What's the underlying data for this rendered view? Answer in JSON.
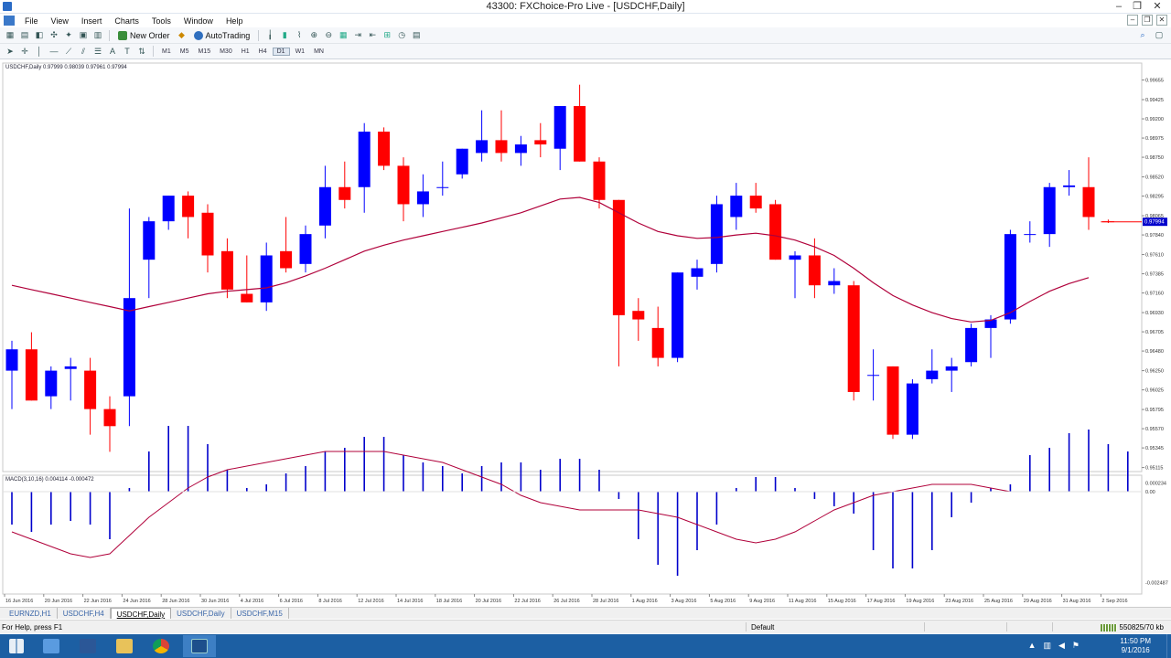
{
  "window": {
    "title": "43300: FXChoice-Pro Live - [USDCHF,Daily]"
  },
  "menu": [
    "File",
    "View",
    "Insert",
    "Charts",
    "Tools",
    "Window",
    "Help"
  ],
  "toolbar": {
    "new_order": "New Order",
    "autotrading": "AutoTrading"
  },
  "timeframes": [
    "M1",
    "M5",
    "M15",
    "M30",
    "H1",
    "H4",
    "D1",
    "W1",
    "MN"
  ],
  "chart": {
    "header": "USDCHF,Daily  0.97999 0.98039 0.97961 0.97994",
    "price_ticks": [
      "0.99655",
      "0.99425",
      "0.99200",
      "0.98975",
      "0.98750",
      "0.98520",
      "0.98295",
      "0.98065",
      "0.97840",
      "0.97610",
      "0.97385",
      "0.97160",
      "0.96930",
      "0.96705",
      "0.96480",
      "0.96250",
      "0.96025",
      "0.95795",
      "0.95570",
      "0.95345",
      "0.95115"
    ],
    "current_price": "0.97994",
    "macd_header": "MACD(3,10,16) 0.004114 -0.000472",
    "macd_ticks": [
      "0.000234",
      "0.00",
      "-0.002487"
    ],
    "date_ticks": [
      "16 Jun 2016",
      "20 Jun 2016",
      "22 Jun 2016",
      "24 Jun 2016",
      "28 Jun 2016",
      "30 Jun 2016",
      "4 Jul 2016",
      "6 Jul 2016",
      "8 Jul 2016",
      "12 Jul 2016",
      "14 Jul 2016",
      "18 Jul 2016",
      "20 Jul 2016",
      "22 Jul 2016",
      "26 Jul 2016",
      "28 Jul 2016",
      "1 Aug 2016",
      "3 Aug 2016",
      "5 Aug 2016",
      "9 Aug 2016",
      "11 Aug 2016",
      "15 Aug 2016",
      "17 Aug 2016",
      "19 Aug 2016",
      "23 Aug 2016",
      "25 Aug 2016",
      "29 Aug 2016",
      "31 Aug 2016",
      "2 Sep 2016"
    ]
  },
  "chart_data": {
    "type": "candlestick",
    "symbol": "USDCHF",
    "timeframe": "Daily",
    "ylim": [
      0.951,
      0.998
    ],
    "up_color": "#0000ff",
    "down_color": "#ff0000",
    "ma_color": "#b0003a",
    "candles": [
      {
        "o": 0.9625,
        "h": 0.966,
        "l": 0.958,
        "c": 0.965
      },
      {
        "o": 0.965,
        "h": 0.967,
        "l": 0.959,
        "c": 0.959
      },
      {
        "o": 0.9595,
        "h": 0.963,
        "l": 0.958,
        "c": 0.9625
      },
      {
        "o": 0.9627,
        "h": 0.964,
        "l": 0.959,
        "c": 0.963
      },
      {
        "o": 0.9625,
        "h": 0.964,
        "l": 0.955,
        "c": 0.958
      },
      {
        "o": 0.958,
        "h": 0.9595,
        "l": 0.953,
        "c": 0.956
      },
      {
        "o": 0.9595,
        "h": 0.9815,
        "l": 0.956,
        "c": 0.971
      },
      {
        "o": 0.9755,
        "h": 0.9805,
        "l": 0.971,
        "c": 0.98
      },
      {
        "o": 0.98,
        "h": 0.983,
        "l": 0.979,
        "c": 0.983
      },
      {
        "o": 0.983,
        "h": 0.9835,
        "l": 0.978,
        "c": 0.9805
      },
      {
        "o": 0.981,
        "h": 0.982,
        "l": 0.974,
        "c": 0.976
      },
      {
        "o": 0.9765,
        "h": 0.978,
        "l": 0.971,
        "c": 0.972
      },
      {
        "o": 0.9715,
        "h": 0.976,
        "l": 0.9705,
        "c": 0.9705
      },
      {
        "o": 0.9705,
        "h": 0.9775,
        "l": 0.9695,
        "c": 0.976
      },
      {
        "o": 0.9765,
        "h": 0.9805,
        "l": 0.974,
        "c": 0.9745
      },
      {
        "o": 0.975,
        "h": 0.9795,
        "l": 0.974,
        "c": 0.9785
      },
      {
        "o": 0.9795,
        "h": 0.9865,
        "l": 0.978,
        "c": 0.984
      },
      {
        "o": 0.984,
        "h": 0.987,
        "l": 0.9815,
        "c": 0.9825
      },
      {
        "o": 0.984,
        "h": 0.9915,
        "l": 0.981,
        "c": 0.9905
      },
      {
        "o": 0.9905,
        "h": 0.991,
        "l": 0.986,
        "c": 0.9865
      },
      {
        "o": 0.9865,
        "h": 0.9875,
        "l": 0.98,
        "c": 0.982
      },
      {
        "o": 0.982,
        "h": 0.9855,
        "l": 0.9805,
        "c": 0.9835
      },
      {
        "o": 0.984,
        "h": 0.987,
        "l": 0.983,
        "c": 0.984
      },
      {
        "o": 0.9855,
        "h": 0.9885,
        "l": 0.985,
        "c": 0.9885
      },
      {
        "o": 0.988,
        "h": 0.993,
        "l": 0.987,
        "c": 0.9895
      },
      {
        "o": 0.9895,
        "h": 0.993,
        "l": 0.987,
        "c": 0.988
      },
      {
        "o": 0.988,
        "h": 0.99,
        "l": 0.9865,
        "c": 0.989
      },
      {
        "o": 0.9895,
        "h": 0.9915,
        "l": 0.9875,
        "c": 0.989
      },
      {
        "o": 0.9885,
        "h": 0.9935,
        "l": 0.986,
        "c": 0.9935
      },
      {
        "o": 0.9935,
        "h": 0.996,
        "l": 0.987,
        "c": 0.987
      },
      {
        "o": 0.987,
        "h": 0.9875,
        "l": 0.9815,
        "c": 0.9825
      },
      {
        "o": 0.9825,
        "h": 0.9825,
        "l": 0.963,
        "c": 0.969
      },
      {
        "o": 0.9695,
        "h": 0.971,
        "l": 0.966,
        "c": 0.9685
      },
      {
        "o": 0.9675,
        "h": 0.97,
        "l": 0.963,
        "c": 0.964
      },
      {
        "o": 0.964,
        "h": 0.974,
        "l": 0.9635,
        "c": 0.974
      },
      {
        "o": 0.9735,
        "h": 0.9755,
        "l": 0.972,
        "c": 0.9745
      },
      {
        "o": 0.975,
        "h": 0.983,
        "l": 0.974,
        "c": 0.982
      },
      {
        "o": 0.9805,
        "h": 0.9845,
        "l": 0.979,
        "c": 0.983
      },
      {
        "o": 0.983,
        "h": 0.9845,
        "l": 0.981,
        "c": 0.9815
      },
      {
        "o": 0.982,
        "h": 0.9825,
        "l": 0.9755,
        "c": 0.9755
      },
      {
        "o": 0.9755,
        "h": 0.9765,
        "l": 0.971,
        "c": 0.976
      },
      {
        "o": 0.976,
        "h": 0.978,
        "l": 0.971,
        "c": 0.9725
      },
      {
        "o": 0.9725,
        "h": 0.9745,
        "l": 0.9715,
        "c": 0.973
      },
      {
        "o": 0.9725,
        "h": 0.973,
        "l": 0.959,
        "c": 0.96
      },
      {
        "o": 0.962,
        "h": 0.965,
        "l": 0.959,
        "c": 0.962
      },
      {
        "o": 0.963,
        "h": 0.963,
        "l": 0.9545,
        "c": 0.955
      },
      {
        "o": 0.955,
        "h": 0.9615,
        "l": 0.9545,
        "c": 0.961
      },
      {
        "o": 0.9615,
        "h": 0.965,
        "l": 0.961,
        "c": 0.9625
      },
      {
        "o": 0.9625,
        "h": 0.964,
        "l": 0.96,
        "c": 0.963
      },
      {
        "o": 0.9635,
        "h": 0.968,
        "l": 0.963,
        "c": 0.9675
      },
      {
        "o": 0.9675,
        "h": 0.969,
        "l": 0.964,
        "c": 0.9685
      },
      {
        "o": 0.9685,
        "h": 0.979,
        "l": 0.968,
        "c": 0.9785
      },
      {
        "o": 0.9785,
        "h": 0.98,
        "l": 0.9775,
        "c": 0.9785
      },
      {
        "o": 0.9785,
        "h": 0.9845,
        "l": 0.977,
        "c": 0.984
      },
      {
        "o": 0.984,
        "h": 0.986,
        "l": 0.983,
        "c": 0.9842
      },
      {
        "o": 0.984,
        "h": 0.9875,
        "l": 0.979,
        "c": 0.9805
      },
      {
        "o": 0.98,
        "h": 0.9802,
        "l": 0.9798,
        "c": 0.9799
      }
    ],
    "ma": [
      0.9725,
      0.972,
      0.9715,
      0.971,
      0.9705,
      0.97,
      0.9695,
      0.97,
      0.9705,
      0.971,
      0.9715,
      0.9718,
      0.972,
      0.9722,
      0.9728,
      0.9736,
      0.9745,
      0.9755,
      0.9765,
      0.9772,
      0.9778,
      0.9783,
      0.9788,
      0.9793,
      0.9798,
      0.9804,
      0.981,
      0.9818,
      0.9826,
      0.9828,
      0.9822,
      0.981,
      0.9798,
      0.9788,
      0.9783,
      0.978,
      0.9781,
      0.9784,
      0.9786,
      0.9783,
      0.9778,
      0.977,
      0.976,
      0.9745,
      0.9728,
      0.9713,
      0.9702,
      0.9693,
      0.9686,
      0.9682,
      0.9684,
      0.9693,
      0.9706,
      0.9718,
      0.9727,
      0.9734
    ],
    "macd": {
      "ylim": [
        -0.0027,
        0.00035
      ],
      "hist": [
        -0.0009,
        -0.0011,
        -0.0009,
        -0.0008,
        -0.0009,
        -0.0013,
        0.0001,
        0.0011,
        0.0018,
        0.0018,
        0.0013,
        0.0006,
        0.0001,
        0.0002,
        0.0005,
        0.0007,
        0.0011,
        0.0012,
        0.0015,
        0.0015,
        0.001,
        0.0008,
        0.0007,
        0.0005,
        0.0007,
        0.0008,
        0.0008,
        0.0006,
        0.0009,
        0.0009,
        0.0006,
        -0.0002,
        -0.0013,
        -0.002,
        -0.0023,
        -0.0016,
        -0.0009,
        0.0001,
        0.0004,
        0.0004,
        0.0001,
        -0.0002,
        -0.0004,
        -0.0006,
        -0.0016,
        -0.0021,
        -0.0021,
        -0.0016,
        -0.0007,
        -0.0003,
        0.0001,
        0.0002,
        0.001,
        0.0012,
        0.0016,
        0.0017,
        0.0013,
        0.0011
      ],
      "signal": [
        -0.0011,
        -0.0013,
        -0.0015,
        -0.0017,
        -0.0018,
        -0.0017,
        -0.0012,
        -0.0007,
        -0.0003,
        0.0001,
        0.0004,
        0.0006,
        0.0007,
        0.0008,
        0.0009,
        0.001,
        0.0011,
        0.0011,
        0.0011,
        0.0011,
        0.001,
        0.0009,
        0.0008,
        0.0006,
        0.0004,
        0.0002,
        -0.0001,
        -0.0003,
        -0.0004,
        -0.0005,
        -0.0005,
        -0.0005,
        -0.0005,
        -0.0006,
        -0.0007,
        -0.0009,
        -0.0011,
        -0.0013,
        -0.0014,
        -0.0013,
        -0.0011,
        -0.0008,
        -0.0005,
        -0.0003,
        -0.0001,
        0.0,
        0.0001,
        0.0002,
        0.0002,
        0.0002,
        0.0001,
        0.0
      ]
    }
  },
  "tabs": [
    "EURNZD,H1",
    "USDCHF,H4",
    "USDCHF,Daily",
    "USDCHF,Daily",
    "USDCHF,M15"
  ],
  "active_tab": 2,
  "status": {
    "help": "For Help, press F1",
    "profile": "Default",
    "traffic": "550825/70 kb"
  },
  "clock": {
    "time": "11:50 PM",
    "date": "9/1/2016"
  },
  "colors": {
    "taskbar": "#1c5fa3",
    "bull": "#0000ff",
    "bear": "#ff0000",
    "ma_line": "#b0003a"
  }
}
